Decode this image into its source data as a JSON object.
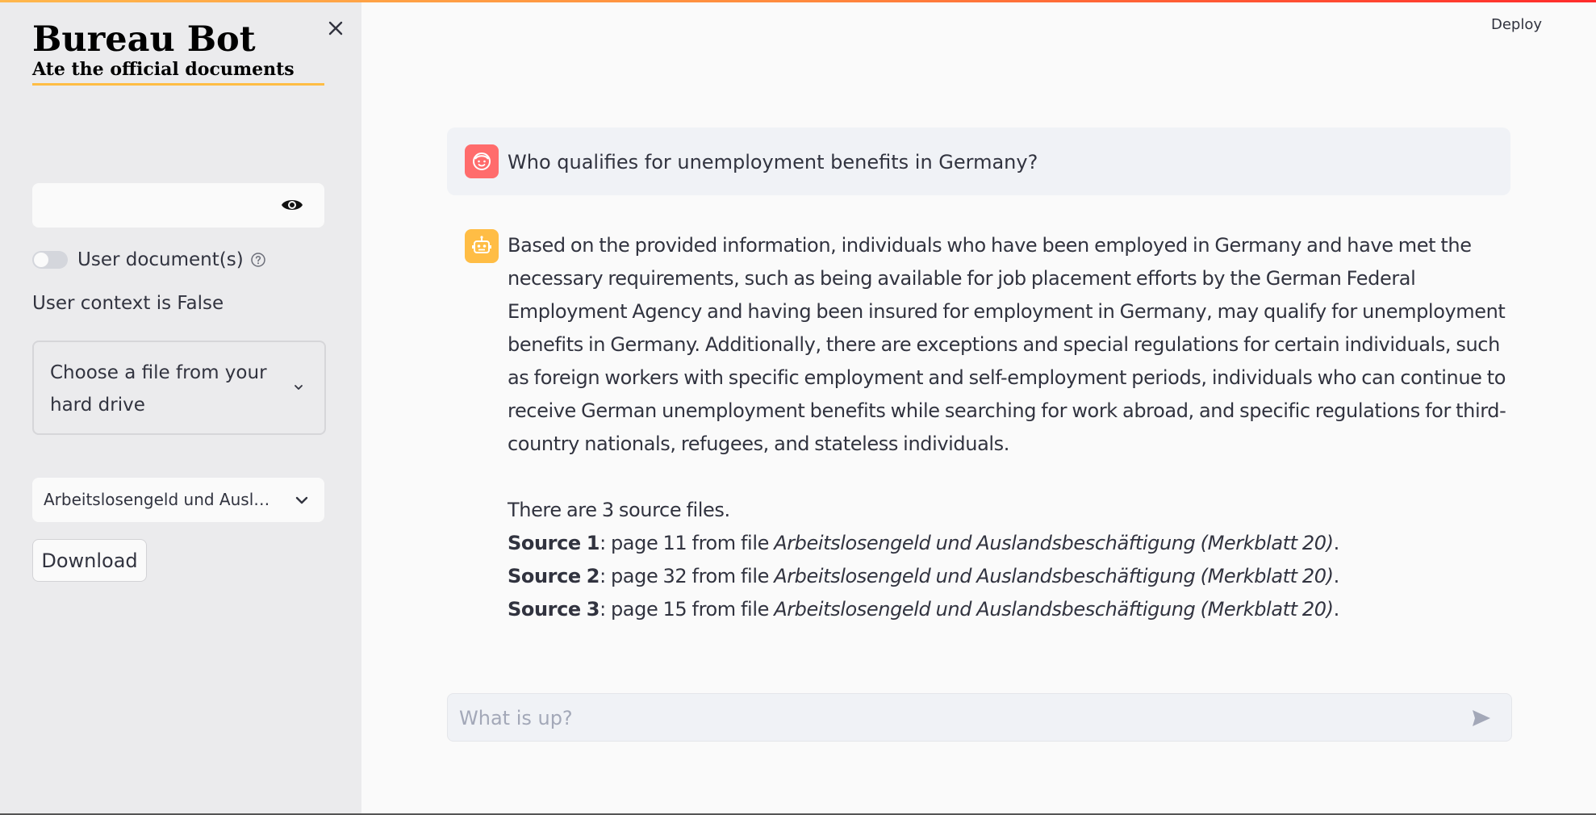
{
  "app": {
    "title": "Bureau Bot",
    "subtitle": "Ate the official documents",
    "accent_color": "#ffbd45"
  },
  "header": {
    "deploy_label": "Deploy"
  },
  "sidebar": {
    "close_icon": "close-icon",
    "password_field": {
      "value": "",
      "icon": "eye-icon"
    },
    "toggle": {
      "label": "User document(s)",
      "checked": false,
      "help_icon": "help-icon"
    },
    "context_status": "User context is False",
    "file_uploader": {
      "label": "Choose a file from your hard drive",
      "icon": "chevron-down-icon"
    },
    "document_select": {
      "value": "Arbeitslosengeld und Auslandsbeschäftigung (Merkblatt 20)",
      "display": "Arbeitslosengeld und Auslan…"
    },
    "download_label": "Download"
  },
  "chat": {
    "messages": [
      {
        "role": "user",
        "avatar_icon": "user-face-icon",
        "avatar_color": "#ff6c6c",
        "text": "Who qualifies for unemployment benefits in Germany?"
      },
      {
        "role": "assistant",
        "avatar_icon": "robot-icon",
        "avatar_color": "#ffbd45",
        "text": "Based on the provided information, individuals who have been employed in Germany and have met the necessary requirements, such as being available for job placement efforts by the German Federal Employment Agency and having been insured for employment in Germany, may qualify for unemployment benefits in Germany. Additionally, there are exceptions and special regulations for certain individuals, such as foreign workers with specific employment and self-employment periods, individuals who can continue to receive German unemployment benefits while searching for work abroad, and specific regulations for third-country nationals, refugees, and stateless individuals.",
        "sources_summary": "There are 3 source files.",
        "sources": [
          {
            "label": "Source 1",
            "text": ": page 11 from file ",
            "file": "Arbeitslosengeld und Auslandsbeschäftigung (Merkblatt 20)",
            "end": "."
          },
          {
            "label": "Source 2",
            "text": ": page 32 from file ",
            "file": "Arbeitslosengeld und Auslandsbeschäftigung (Merkblatt 20)",
            "end": "."
          },
          {
            "label": "Source 3",
            "text": ": page 15 from file ",
            "file": "Arbeitslosengeld und Auslandsbeschäftigung (Merkblatt 20)",
            "end": "."
          }
        ]
      }
    ],
    "input": {
      "placeholder": "What is up?",
      "value": "",
      "send_icon": "send-icon"
    }
  }
}
